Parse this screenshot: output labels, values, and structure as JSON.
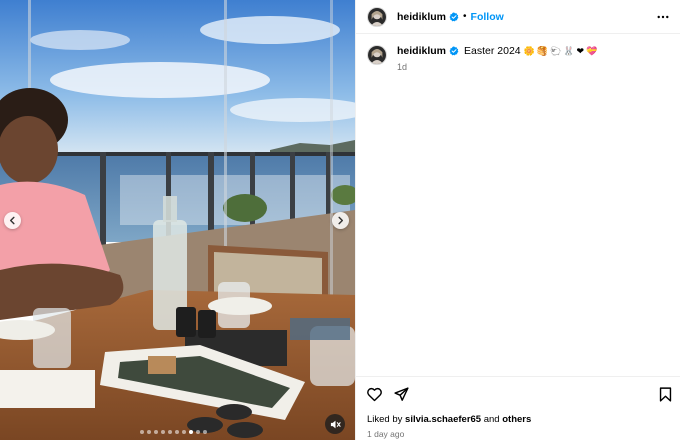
{
  "post": {
    "author": "heidiklum",
    "follow_label": "Follow",
    "separator": "•",
    "caption_text": "Easter 2024",
    "caption_emojis": [
      "🌼",
      "🥞",
      "🐑",
      "🐰",
      "❤",
      "💝"
    ],
    "caption_time": "1d",
    "liked_by_prefix": "Liked by",
    "liked_by_user": "silvia.schaefer65",
    "liked_by_and": "and",
    "liked_by_others": "others",
    "posted_time": "1 day ago"
  },
  "carousel": {
    "dot_count": 10,
    "active_index": 7
  },
  "icons": {
    "verified": "verified-badge-icon",
    "more": "more-options-icon",
    "like": "heart-icon",
    "share": "share-icon",
    "save": "bookmark-icon",
    "prev": "chevron-left-icon",
    "next": "chevron-right-icon",
    "mute": "speaker-muted-icon"
  },
  "colors": {
    "link": "#0095f6",
    "verified": "#0095f6",
    "muted_text": "#737373"
  }
}
